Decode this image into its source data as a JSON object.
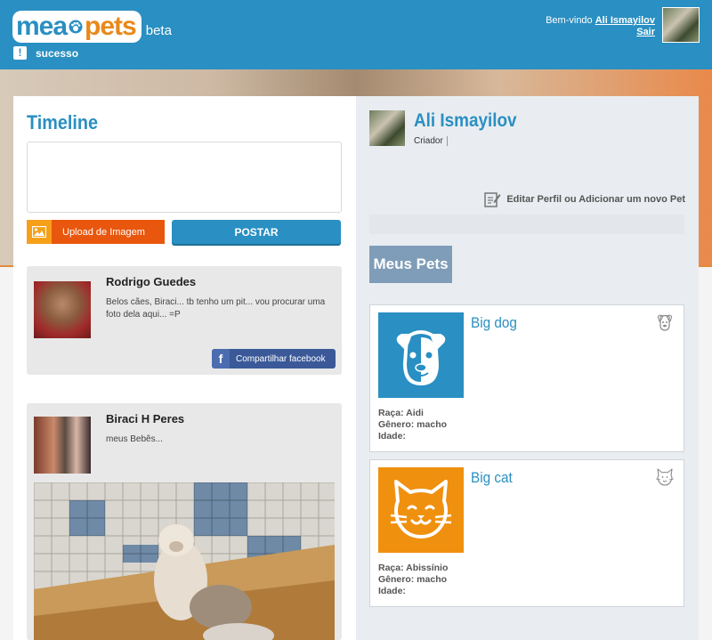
{
  "header": {
    "logo_mea": "mea",
    "logo_pets": "pets",
    "logo_beta": "beta",
    "welcome_prefix": "Bem-vindo",
    "user_name": "Ali Ismayilov",
    "logout": "Sair"
  },
  "flash": {
    "icon": "!",
    "message": "sucesso"
  },
  "timeline": {
    "title": "Timeline",
    "textarea_value": "",
    "upload_label": "Upload de Imagem",
    "post_label": "POSTAR"
  },
  "posts": [
    {
      "author": "Rodrigo Guedes",
      "text": "Belos cães, Biraci... tb tenho um pit... vou procurar uma foto dela aqui... =P",
      "share_label": "Compartilhar facebook"
    },
    {
      "author": "Biraci H Peres",
      "text": "meus Bebês..."
    }
  ],
  "profile": {
    "name": "Ali Ismayilov",
    "role": "Criador",
    "edit_label": "Editar Perfil ou Adicionar um novo Pet",
    "pets_title": "Meus Pets"
  },
  "pets": [
    {
      "name": "Big dog",
      "icon": "dog-icon",
      "raca": "Raça: Aidi",
      "genero": "Gênero: macho",
      "idade": "Idade:"
    },
    {
      "name": "Big cat",
      "icon": "cat-icon",
      "raca": "Raça: Abissínio",
      "genero": "Gênero: macho",
      "idade": "Idade:"
    }
  ],
  "colors": {
    "brand_blue": "#2a8fc2",
    "brand_orange": "#e8891b",
    "upload_orange": "#e8570d",
    "facebook": "#3b5998",
    "pets_header": "#7f9db8"
  }
}
